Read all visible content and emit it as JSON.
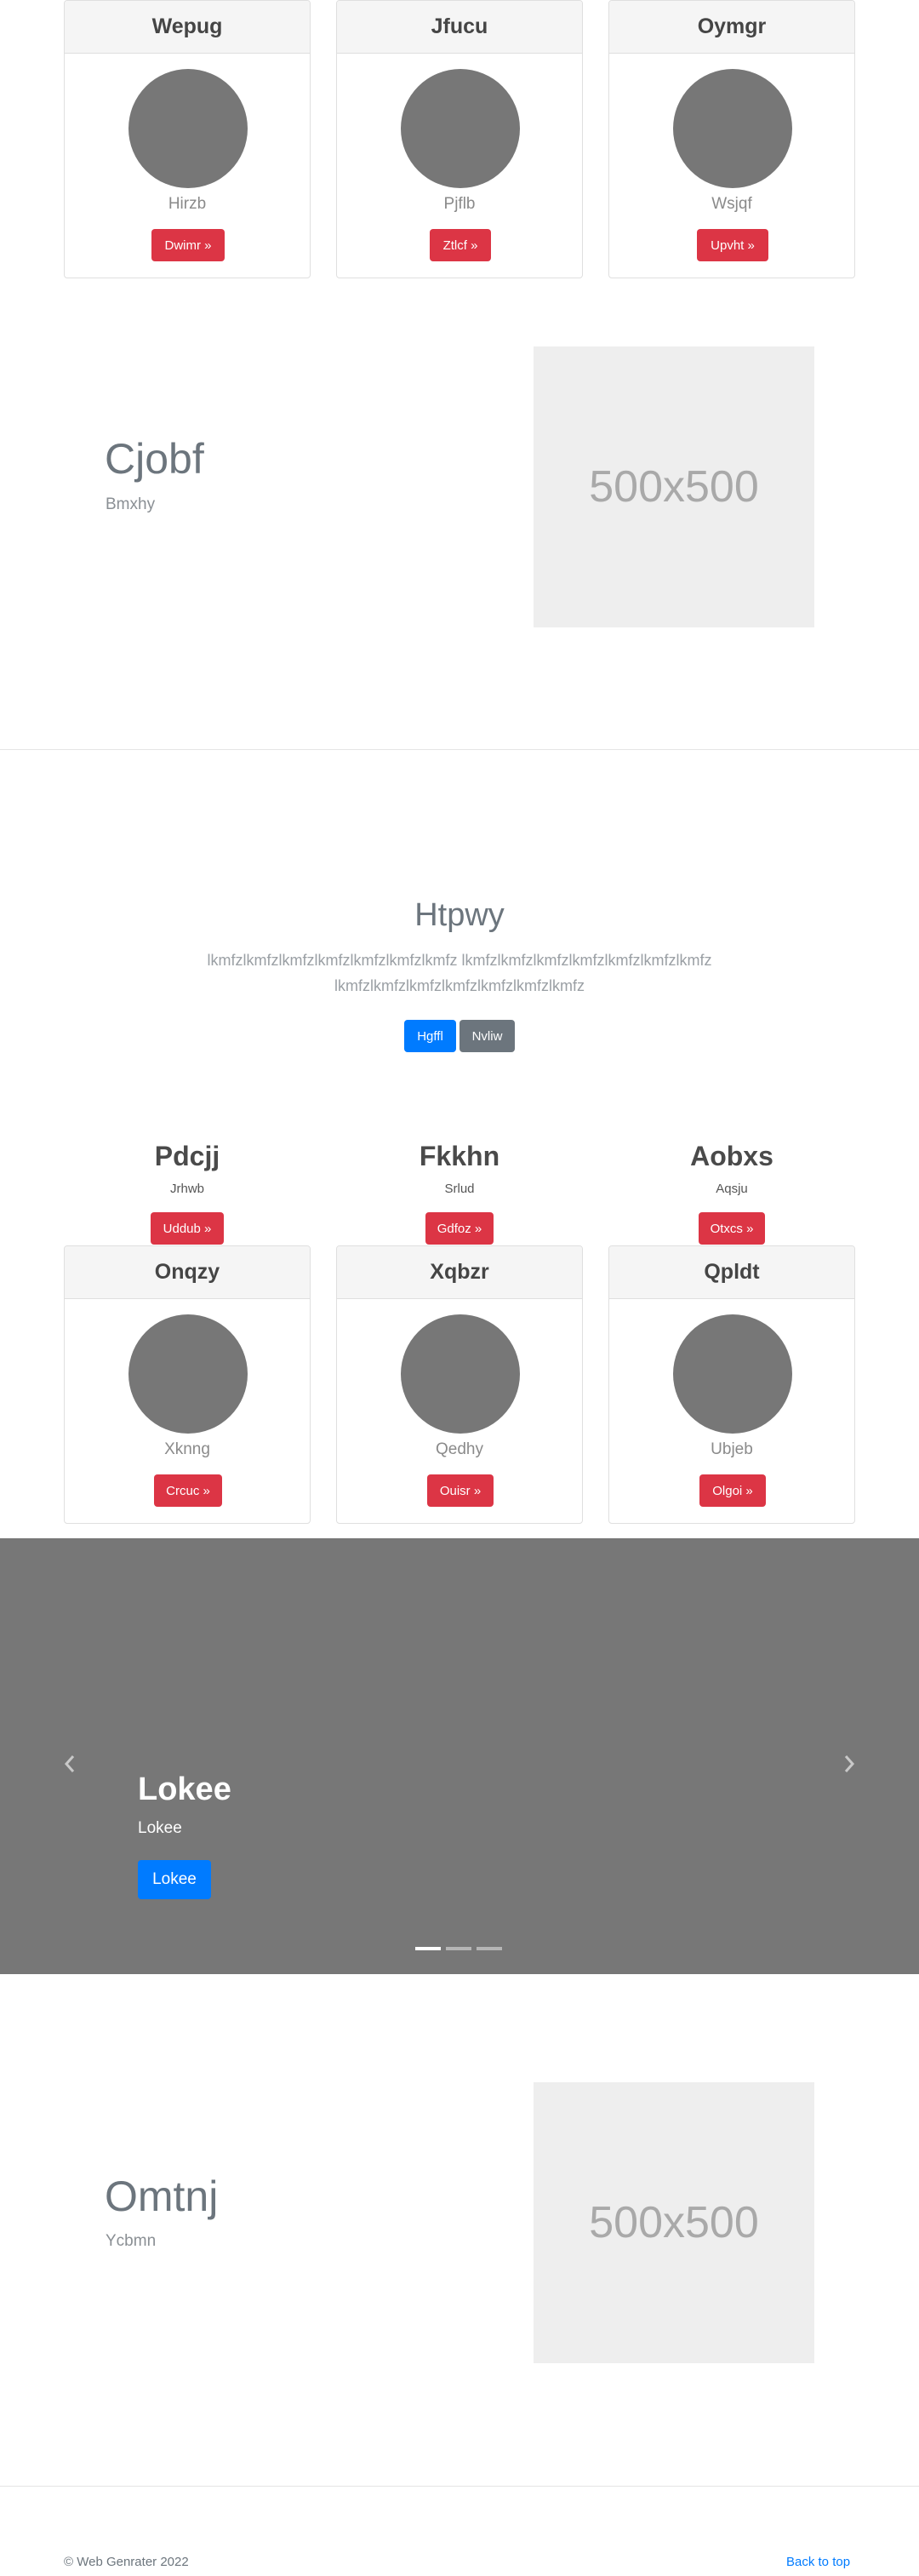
{
  "cards_top": [
    {
      "title": "Wepug",
      "subtitle": "Hirzb",
      "button": "Dwimr »"
    },
    {
      "title": "Jfucu",
      "subtitle": "Pjflb",
      "button": "Ztlcf »"
    },
    {
      "title": "Oymgr",
      "subtitle": "Wsjqf",
      "button": "Upvht »"
    }
  ],
  "feature1": {
    "title": "Cjobf",
    "subtitle": "Bmxhy",
    "image_label": "500x500"
  },
  "jumbotron": {
    "title": "Htpwy",
    "text_line1": "lkmfzlkmfzlkmfzlkmfzlkmfzlkmfzlkmfz lkmfzlkmfzlkmfzlkmfzlkmfzlkmfzlkmfz",
    "text_line2": "lkmfzlkmfzlkmfzlkmfzlkmfzlkmfzlkmfz",
    "primary_button": "Hgffl",
    "secondary_button": "Nvliw"
  },
  "features": [
    {
      "title": "Pdcjj",
      "subtitle": "Jrhwb",
      "button": "Uddub »"
    },
    {
      "title": "Fkkhn",
      "subtitle": "Srlud",
      "button": "Gdfoz »"
    },
    {
      "title": "Aobxs",
      "subtitle": "Aqsju",
      "button": "Otxcs »"
    }
  ],
  "cards_bottom": [
    {
      "title": "Onqzy",
      "subtitle": "Xknng",
      "button": "Crcuc »"
    },
    {
      "title": "Xqbzr",
      "subtitle": "Qedhy",
      "button": "Ouisr »"
    },
    {
      "title": "Qpldt",
      "subtitle": "Ubjeb",
      "button": "Olgoi »"
    }
  ],
  "carousel": {
    "title": "Lokee",
    "subtitle": "Lokee",
    "button": "Lokee",
    "prev_icon": "chevron-left-icon",
    "next_icon": "chevron-right-icon",
    "slide_count": 3,
    "active_slide": 1
  },
  "feature2": {
    "title": "Omtnj",
    "subtitle": "Ycbmn",
    "image_label": "500x500"
  },
  "footer": {
    "copyright": "© Web Genrater 2022",
    "back_to_top": "Back to top"
  },
  "colors": {
    "danger": "#dc3545",
    "primary": "#007bff",
    "secondary": "#6c757d",
    "carousel_bg": "#777777"
  }
}
